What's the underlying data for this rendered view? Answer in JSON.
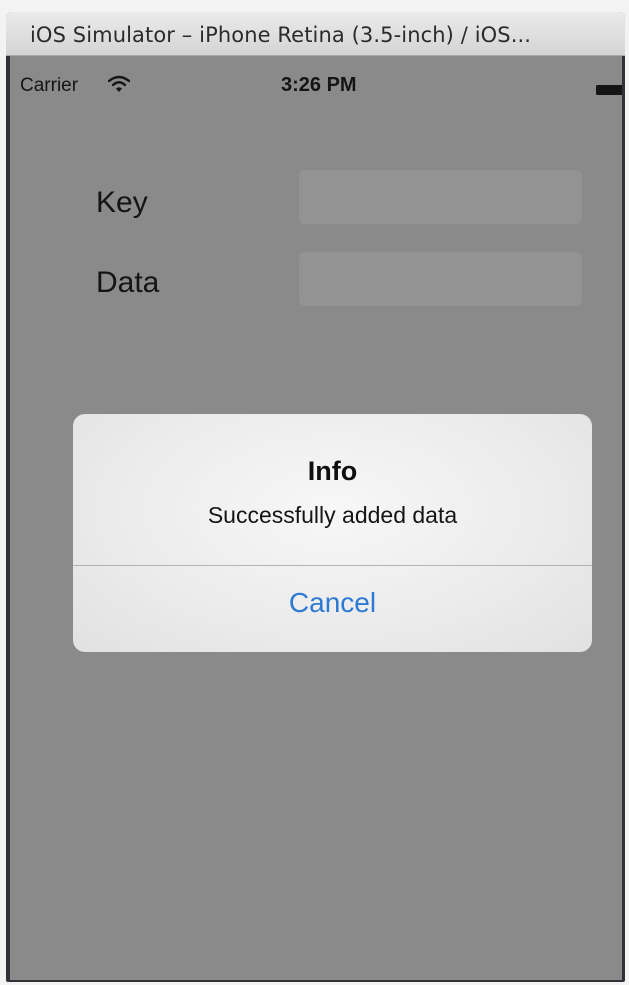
{
  "window": {
    "title": "iOS Simulator – iPhone Retina (3.5-inch) / iOS..."
  },
  "status_bar": {
    "carrier": "Carrier",
    "time": "3:26 PM",
    "wifi_icon": "wifi-icon",
    "battery_icon": "battery-icon"
  },
  "form": {
    "key_label": "Key",
    "key_value": "",
    "data_label": "Data",
    "data_value": ""
  },
  "alert": {
    "title": "Info",
    "message": "Successfully added data",
    "cancel_label": "Cancel"
  },
  "colors": {
    "accent": "#2d79d3",
    "dimmed_background": "#8a8a8a",
    "alert_background": "#ececec"
  }
}
